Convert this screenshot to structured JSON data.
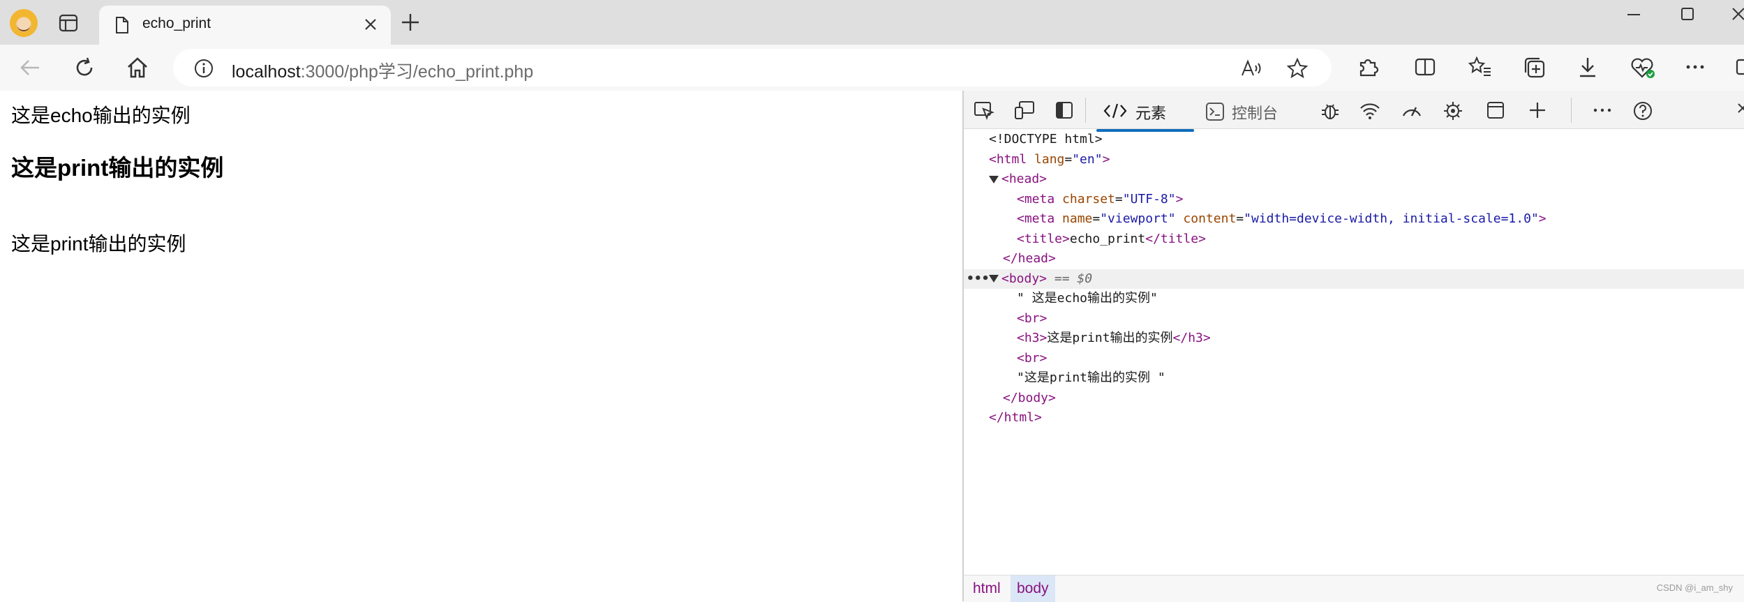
{
  "tab": {
    "title": "echo_print"
  },
  "address": {
    "host": "localhost",
    "path": ":3000/php学习/echo_print.php"
  },
  "page": {
    "echo_line": "这是echo输出的实例",
    "h3": "这是print输出的实例",
    "print_line": "这是print输出的实例"
  },
  "devtools": {
    "tab_elements": "元素",
    "tab_console": "控制台",
    "dom": {
      "doctype": "<!DOCTYPE html>",
      "html_open_tag": "<html",
      "html_lang_attr": " lang",
      "html_lang_val": "\"en\"",
      "head_tag": "<head>",
      "meta1_tag": "<meta",
      "meta1_attr": " charset",
      "meta1_val": "\"UTF-8\"",
      "meta2_tag": "<meta",
      "meta2_name_attr": " name",
      "meta2_name_val": "\"viewport\"",
      "meta2_content_attr": " content",
      "meta2_content_val": "\"width=device-width, initial-scale=1.0\"",
      "title_open": "<title>",
      "title_text": "echo_print",
      "title_close": "</title>",
      "head_close": "</head>",
      "body_tag": "<body>",
      "body_marker": " == $0",
      "text1": "\" 这是echo输出的实例\"",
      "br1": "<br>",
      "h3_open": "<h3>",
      "h3_text": "这是print输出的实例",
      "h3_close": "</h3>",
      "br2": "<br>",
      "text2": "\"这是print输出的实例 \"",
      "body_close": "</body>",
      "html_close": "</html>"
    },
    "breadcrumbs": [
      "html",
      "body"
    ],
    "watermark": "CSDN @i_am_shy"
  },
  "colors": {
    "accent": "#0f6cbd",
    "tag": "#881280",
    "attr_name": "#994500",
    "attr_value": "#1a1aa6"
  }
}
